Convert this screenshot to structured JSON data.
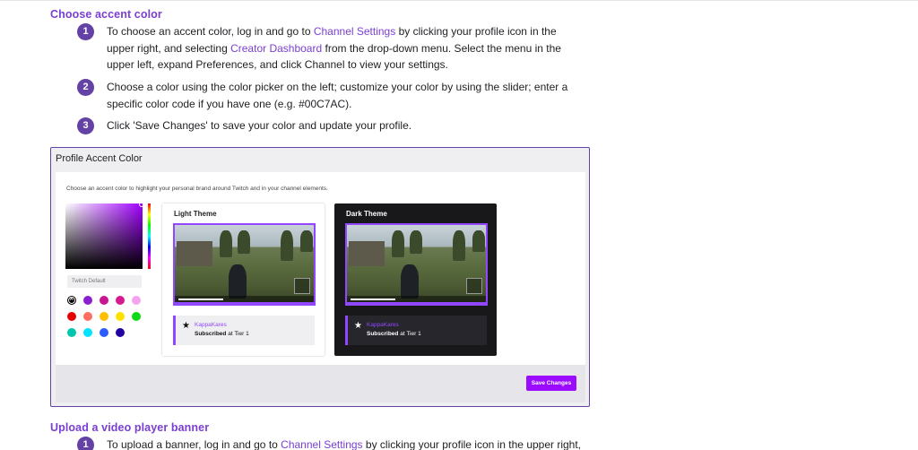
{
  "sections": [
    {
      "title": "Choose accent color",
      "steps": [
        {
          "num": "1",
          "part1": "To choose an accent color, log in and go to ",
          "link1": "Channel Settings",
          "part2": " by clicking your profile icon in the upper right, and selecting ",
          "link2": "Creator Dashboard",
          "part3": " from the drop-down menu. Select the menu in the upper left, expand Preferences, and click Channel to view your settings."
        },
        {
          "num": "2",
          "text": "Choose a color using the color picker on the left; customize your color by using the slider; enter a specific color code if you have one (e.g. #00C7AC)."
        },
        {
          "num": "3",
          "text": "Click 'Save Changes' to save your color and update your profile."
        }
      ]
    },
    {
      "title": "Upload a video player banner",
      "steps": [
        {
          "num": "1",
          "part1": "To upload a banner, log in and go to ",
          "link1": "Channel Settings",
          "part2": " by clicking your profile icon in the upper right, and"
        }
      ]
    }
  ],
  "panel": {
    "title": "Profile Accent Color",
    "description": "Choose an accent color to highlight your personal brand around Twitch and in your channel elements.",
    "color_input_placeholder": "Twitch Default",
    "swatches": [
      "#000000",
      "#8a1fd1",
      "#c9158f",
      "#d6198f",
      "#f5a3ef",
      "#e60000",
      "#ff6f61",
      "#ffbf00",
      "#ffe100",
      "#0dd917",
      "#00c7ac",
      "#00e5ff",
      "#2b5cff",
      "#2400a3"
    ],
    "light_theme": {
      "label": "Light Theme",
      "sub_name": "KappaKares",
      "sub_prefix": "Subscribed",
      "sub_suffix": " at Tier 1"
    },
    "dark_theme": {
      "label": "Dark Theme",
      "sub_name": "KappaKares",
      "sub_prefix": "Subscribed",
      "sub_suffix": " at Tier 1"
    },
    "save_label": "Save Changes"
  },
  "colors": {
    "heading": "#7a3fd1",
    "step_badge": "#6441a5",
    "accent": "#9147ff",
    "save_button": "#9a0bff"
  },
  "icons": {
    "step_badge": "numbered-circle",
    "star": "star-icon",
    "selected_swatch": "close-icon"
  }
}
